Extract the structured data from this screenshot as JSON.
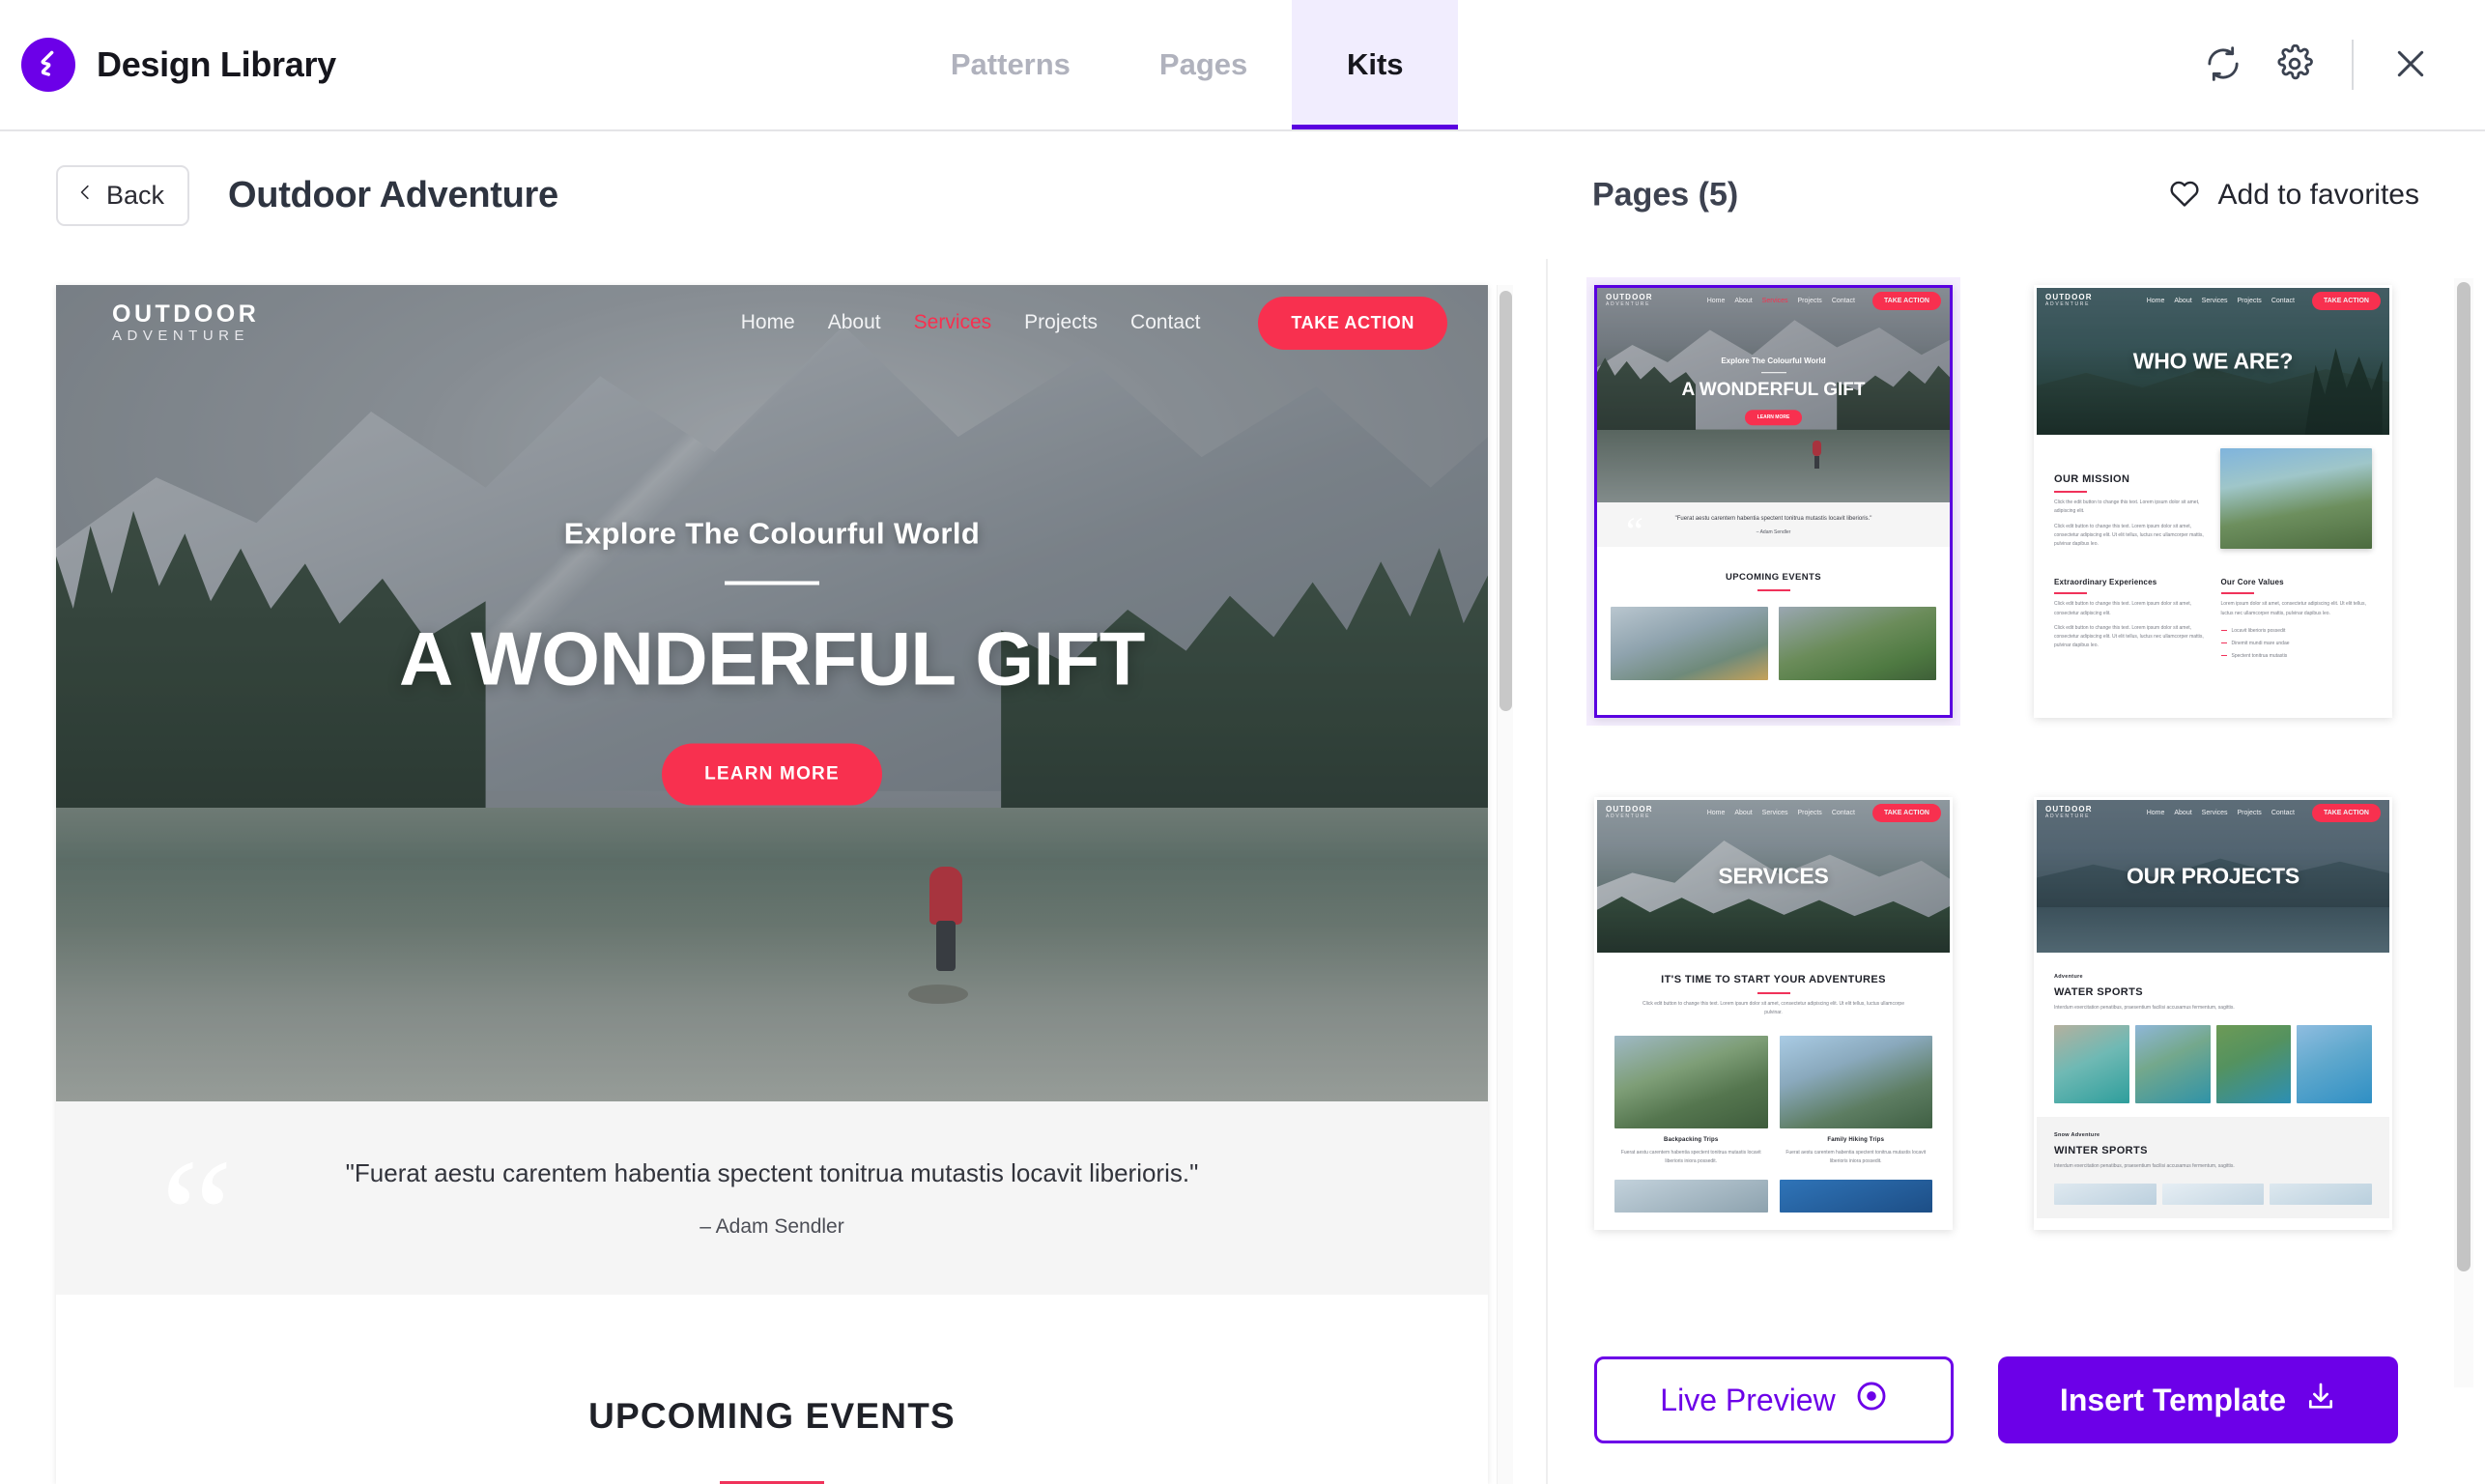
{
  "app": {
    "brand_title": "Design Library",
    "logo_icon": "lightning-bolt-icon",
    "accent_purple": "#6c00e8",
    "accent_pink": "#f8304f"
  },
  "tabs": [
    {
      "label": "Patterns",
      "active": false
    },
    {
      "label": "Pages",
      "active": false
    },
    {
      "label": "Kits",
      "active": true
    }
  ],
  "topbar_actions": [
    {
      "name": "refresh-icon",
      "label": "Refresh"
    },
    {
      "name": "gear-icon",
      "label": "Settings"
    },
    {
      "name": "close-icon",
      "label": "Close"
    }
  ],
  "subheader": {
    "back_label": "Back",
    "back_icon": "chevron-left-icon",
    "kit_title": "Outdoor Adventure",
    "pages_count_label": "Pages (5)",
    "favorites_label": "Add to favorites",
    "favorites_icon": "heart-icon"
  },
  "preview": {
    "site_logo_line1": "OUTDOOR",
    "site_logo_line2": "ADVENTURE",
    "nav": [
      {
        "label": "Home",
        "selected": false
      },
      {
        "label": "About",
        "selected": false
      },
      {
        "label": "Services",
        "selected": true
      },
      {
        "label": "Projects",
        "selected": false
      },
      {
        "label": "Contact",
        "selected": false
      }
    ],
    "cta_label": "TAKE ACTION",
    "hero_subtitle": "Explore The Colourful World",
    "hero_title": "A WONDERFUL GIFT",
    "hero_button": "LEARN MORE",
    "quote_text": "\"Fuerat aestu carentem habentia spectent tonitrua mutastis locavit liberioris.\"",
    "quote_author": "– Adam Sendler",
    "quote_mark": "“",
    "events_title": "UPCOMING EVENTS"
  },
  "pages_panel": {
    "thumbnails": [
      {
        "name": "home",
        "selected": true,
        "hero_title": "A WONDERFUL GIFT",
        "hero_subtitle": "Explore The Colourful World",
        "hero_button": "LEARN MORE",
        "quote_text": "\"Fuerat aestu carentem habentia spectent tonitrua mutastis locavit liberioris.\"",
        "quote_author": "– Adam Sendler",
        "section_title": "UPCOMING EVENTS"
      },
      {
        "name": "about",
        "selected": false,
        "hero_title": "WHO WE ARE?",
        "section_title": "OUR MISSION",
        "body1": "Click the edit button to change this text. Lorem ipsum dolor sit amet, adipiscing elit.",
        "body2": "Click edit button to change this text. Lorem ipsum dolor sit amet, consectetur adipiscing elit. Ut elit tellus, luctus nec ullamcorper mattis, pulvinar dapibus leo.",
        "sub1_title": "Extraordinary Experiences",
        "sub1_body": "Click edit button to change this text. Lorem ipsum dolor sit amet, consectetur adipiscing elit.",
        "sub2_title": "Our Core Values",
        "sub2_body": "Lorem ipsum dolor sit amet, consectetur adipiscing elit. Ut elit tellus, luctus nec ullamcorper mattis, pulvinar dapibus leo.",
        "list": [
          "Locavit liberioris possedit",
          "Dinemit mundi mare undae",
          "Spectent tonitrua mutastis"
        ]
      },
      {
        "name": "services",
        "selected": false,
        "hero_title": "SERVICES",
        "section_title": "IT'S TIME TO START YOUR ADVENTURES",
        "section_body": "Click edit button to change this text. Lorem ipsum dolor sit amet, consectetur adipiscing elit. Ut elit tellus, luctus ullamcorpe pulvinar.",
        "cards": [
          {
            "title": "Backpacking Trips",
            "body": "Fuerat aestu carentem habentia spectent tonitrua mutastis locavit liberioris iniora possedit."
          },
          {
            "title": "Family Hiking Trips",
            "body": "Fuerat aestu carentem habentia spectent tonitrua mutastis locavit liberioris iniora possedit."
          }
        ]
      },
      {
        "name": "projects",
        "selected": false,
        "hero_title": "OUR PROJECTS",
        "eyebrow1": "Adventure",
        "section1_title": "WATER SPORTS",
        "section1_body": "Interdum exercitation penatibus, praesentium facilisi accusamus fermentum, sagittis.",
        "eyebrow2": "Snow Adventure",
        "section2_title": "WINTER SPORTS",
        "section2_body": "Interdum exercitation penatibus, praesentium facilisi accusamus fermentum, sagittis."
      }
    ],
    "live_preview_label": "Live Preview",
    "live_preview_icon": "eye-circle-icon",
    "insert_template_label": "Insert Template",
    "insert_template_icon": "download-icon"
  }
}
